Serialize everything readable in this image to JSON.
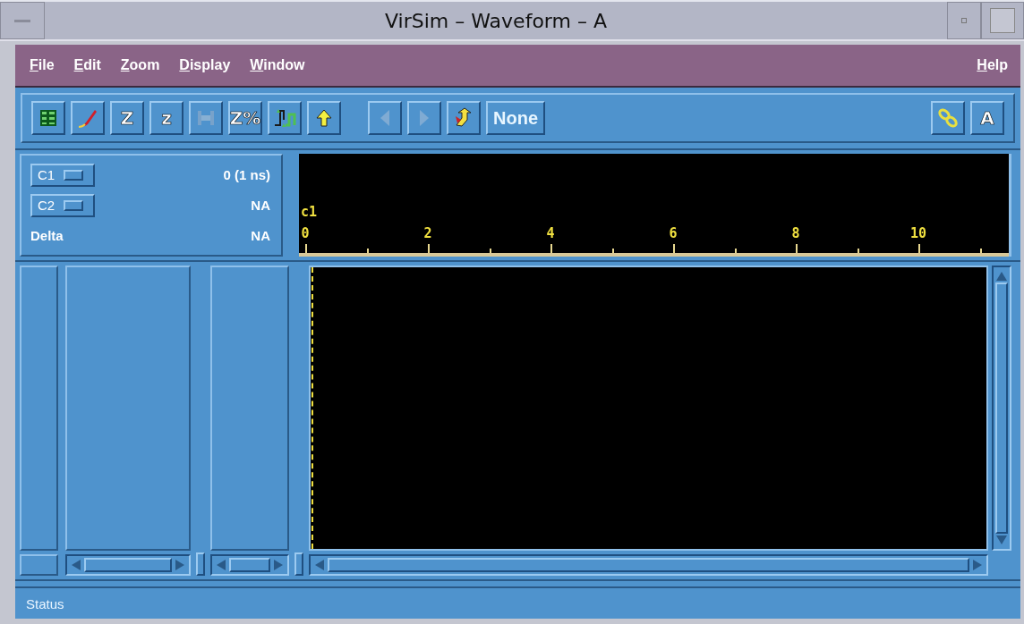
{
  "window": {
    "title": "VirSim – Waveform – A"
  },
  "menu": {
    "left": [
      {
        "label": "File"
      },
      {
        "label": "Edit"
      },
      {
        "label": "Zoom"
      },
      {
        "label": "Display"
      },
      {
        "label": "Window"
      }
    ],
    "right": [
      {
        "label": "Help"
      }
    ]
  },
  "toolbar": {
    "tools": [
      {
        "kind": "signal-list",
        "disabled": false
      },
      {
        "kind": "pen",
        "disabled": false
      },
      {
        "kind": "text",
        "label": "Z",
        "disabled": false
      },
      {
        "kind": "text",
        "label": "z",
        "disabled": false
      },
      {
        "kind": "zoom-fit",
        "disabled": true
      },
      {
        "kind": "text",
        "label": "Z%",
        "disabled": false
      },
      {
        "kind": "edge",
        "disabled": false
      },
      {
        "kind": "up-arrow",
        "disabled": false
      }
    ],
    "nav": [
      {
        "kind": "left",
        "disabled": true
      },
      {
        "kind": "right",
        "disabled": true
      },
      {
        "kind": "marker",
        "disabled": false
      }
    ],
    "field": {
      "value": "None"
    },
    "right": [
      {
        "kind": "link",
        "disabled": false
      },
      {
        "kind": "text",
        "label": "A",
        "disabled": false
      }
    ]
  },
  "cursors": [
    {
      "label": "C1",
      "value": "0 (1 ns)"
    },
    {
      "label": "C2",
      "value": "NA"
    }
  ],
  "delta": {
    "label": "Delta",
    "value": "NA"
  },
  "ruler": {
    "cursor_label": "c1",
    "ticks": [
      "0",
      "2",
      "4",
      "6",
      "8",
      "10"
    ]
  },
  "status_bar": {
    "text": "Status"
  }
}
